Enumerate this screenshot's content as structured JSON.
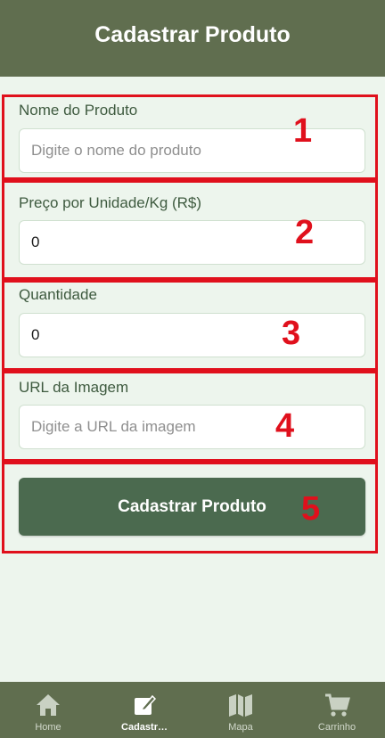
{
  "header": {
    "title": "Cadastrar Produto"
  },
  "form": {
    "name": {
      "label": "Nome do Produto",
      "placeholder": "Digite o nome do produto",
      "value": ""
    },
    "price": {
      "label": "Preço por Unidade/Kg (R$)",
      "placeholder": "",
      "value": "0"
    },
    "quantity": {
      "label": "Quantidade",
      "placeholder": "",
      "value": "0"
    },
    "image_url": {
      "label": "URL da Imagem",
      "placeholder": "Digite a URL da imagem",
      "value": ""
    },
    "submit_label": "Cadastrar Produto"
  },
  "annotations": [
    "1",
    "2",
    "3",
    "4",
    "5"
  ],
  "tabs": [
    {
      "label": "Home",
      "icon": "home-icon",
      "active": false
    },
    {
      "label": "Cadastr…",
      "icon": "edit-icon",
      "active": true
    },
    {
      "label": "Mapa",
      "icon": "map-icon",
      "active": false
    },
    {
      "label": "Carrinho",
      "icon": "cart-icon",
      "active": false
    }
  ],
  "colors": {
    "header_bg": "#606e4f",
    "page_bg": "#edf5ed",
    "button_bg": "#4b6a4f",
    "annotation": "#e0101c"
  }
}
